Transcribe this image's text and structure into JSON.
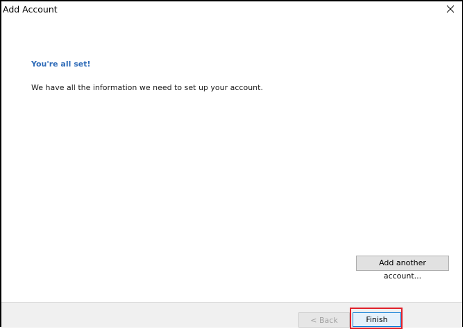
{
  "window": {
    "title": "Add Account",
    "close_icon": "close-icon"
  },
  "content": {
    "heading": "You're all set!",
    "message": "We have all the information we need to set up your account."
  },
  "actions": {
    "add_another_label": "Add another account...",
    "back_label": "< Back",
    "finish_label": "Finish"
  },
  "colors": {
    "heading": "#2e6bb8",
    "highlight": "#e0202a",
    "focus_border": "#0078d7"
  }
}
